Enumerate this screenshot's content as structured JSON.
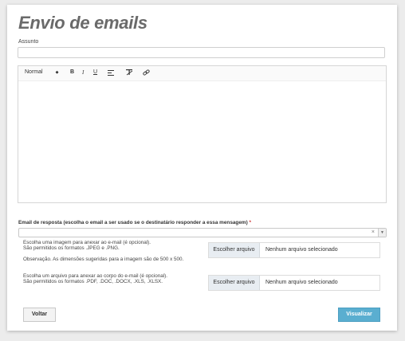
{
  "page": {
    "title": "Envio de emails"
  },
  "subject": {
    "label": "Assunto",
    "value": ""
  },
  "editor": {
    "toolbar": {
      "size_label": "Normal",
      "bold_label": "B",
      "italic_label": "I",
      "underline_label": "U"
    },
    "content": ""
  },
  "reply_email": {
    "label": "Email de resposta (escolha o email a ser usado se o destinatário responder a essa mensagem)",
    "required_mark": "*",
    "clear_label": "×",
    "value": ""
  },
  "image_upload": {
    "hint_line1": "Escolha uma imagem para anexar ao e-mail (é opcional).",
    "hint_line2": "São permitidos os formatos .JPEG e .PNG.",
    "hint_note": "Observação. As dimensões sugeridas para a imagem são de 500 x 500.",
    "button_label": "Escolher arquivo",
    "status": "Nenhum arquivo selecionado"
  },
  "file_upload": {
    "hint_line1": "Escolha um arquivo para anexar ao corpo do e-mail (é opcional).",
    "hint_line2": "São permitidos os formatos .PDF, .DOC, .DOCX, .XLS, .XLSX.",
    "button_label": "Escolher arquivo",
    "status": "Nenhum arquivo selecionado"
  },
  "actions": {
    "back_label": "Voltar",
    "preview_label": "Visualizar"
  },
  "colors": {
    "primary_button": "#5aaed0",
    "title": "#6a6a6a"
  }
}
